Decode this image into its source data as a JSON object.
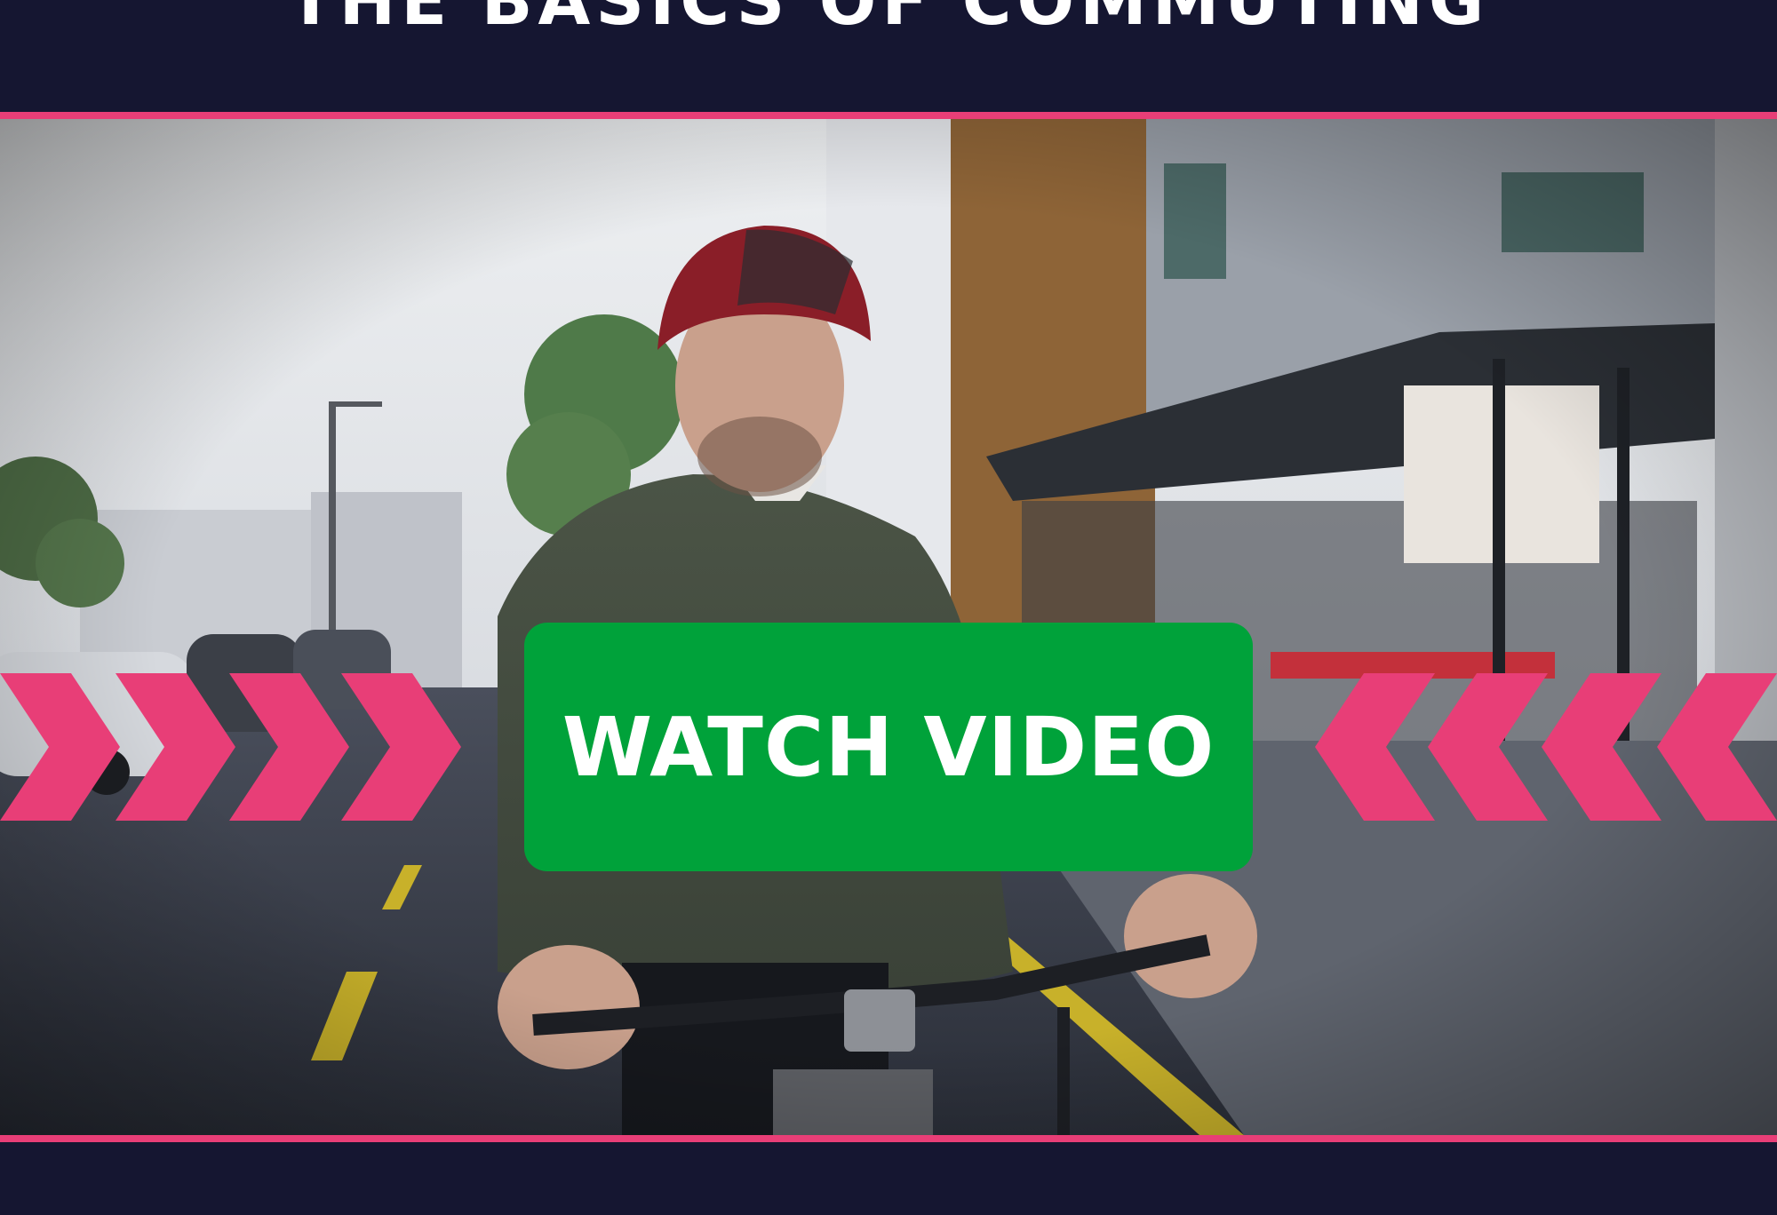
{
  "header": {
    "title": "THE BASICS OF COMMUTING"
  },
  "video": {
    "cta_label": "WATCH VIDEO"
  },
  "colors": {
    "background": "#151631",
    "accent_pink": "#e83e77",
    "button_green": "#00a23a",
    "text_white": "#ffffff"
  },
  "icons": {
    "left_arrows": "chevron-right-icon",
    "right_arrows": "chevron-left-icon"
  }
}
